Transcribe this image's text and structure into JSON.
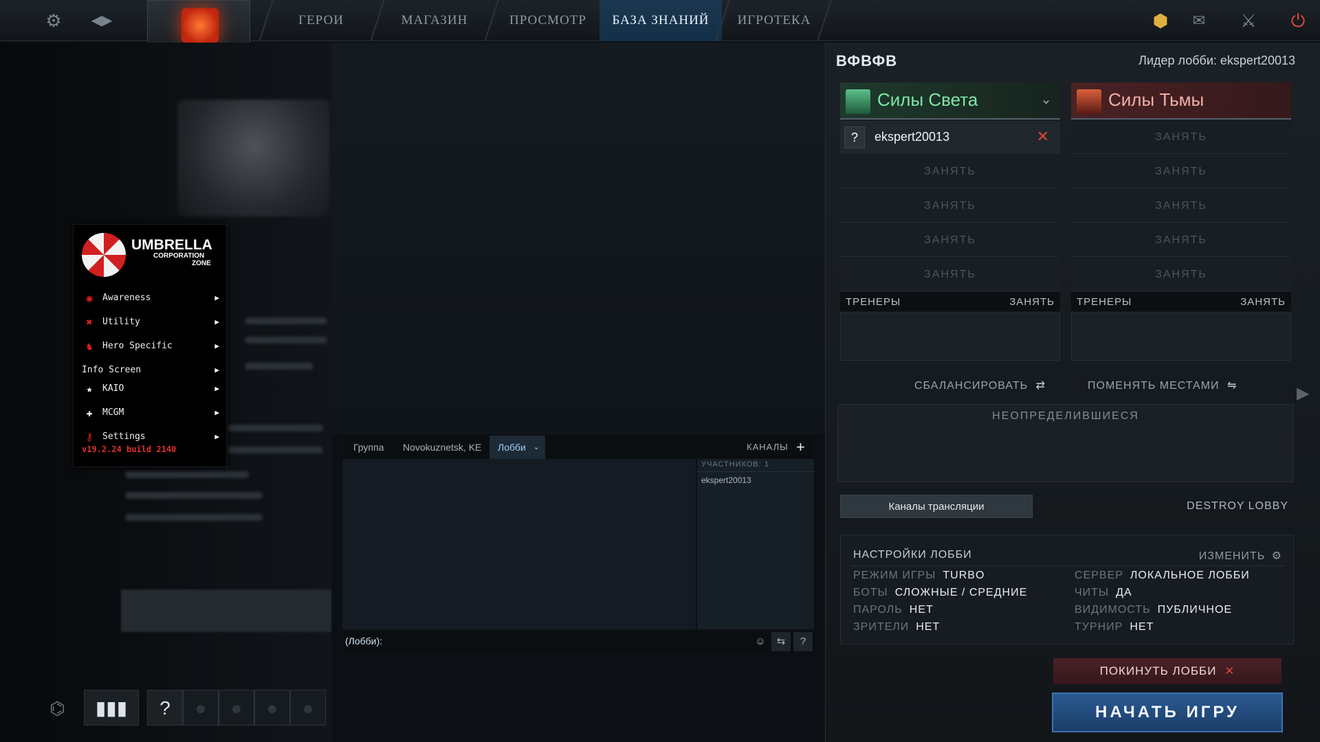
{
  "nav": {
    "items": [
      "ГЕРОИ",
      "МАГАЗИН",
      "ПРОСМОТР",
      "БАЗА ЗНАНИЙ",
      "ИГРОТЕКА"
    ],
    "active_index": 3
  },
  "umbrella_menu": {
    "logo_line1": "UMBRELLA",
    "logo_line2": "CORPORATION",
    "logo_line3": "ZONE",
    "items": [
      {
        "icon": "eye-icon",
        "label": "Awareness"
      },
      {
        "icon": "tools-icon",
        "label": "Utility"
      },
      {
        "icon": "hero-icon",
        "label": "Hero Specific"
      },
      {
        "icon": "",
        "label": "Info Screen"
      },
      {
        "icon": "star-icon",
        "label": "KAIO"
      },
      {
        "icon": "plus-icon",
        "label": "MCGM"
      },
      {
        "icon": "settings-key-icon",
        "label": "Settings"
      }
    ],
    "version": "v19.2.24 build 2140"
  },
  "chat": {
    "tabs": [
      "Группа",
      "Novokuznetsk, KE",
      "Лобби"
    ],
    "active_tab": 2,
    "channels_label": "КАНАЛЫ",
    "members_header": "УЧАСТНИКОВ: 1",
    "members": [
      "ekspert20013"
    ],
    "input_prefix": "(Лобби):"
  },
  "lobby": {
    "name": "ВФВФВ",
    "leader": "Лидер лобби: ekspert20013",
    "radiant": {
      "name": "Силы Света",
      "slots": [
        "ekspert20013",
        "ЗАНЯТЬ",
        "ЗАНЯТЬ",
        "ЗАНЯТЬ",
        "ЗАНЯТЬ"
      ],
      "coaches_label": "ТРЕНЕРЫ",
      "coaches_take": "ЗАНЯТЬ"
    },
    "dire": {
      "name": "Силы Тьмы",
      "slots": [
        "ЗАНЯТЬ",
        "ЗАНЯТЬ",
        "ЗАНЯТЬ",
        "ЗАНЯТЬ",
        "ЗАНЯТЬ"
      ],
      "coaches_label": "ТРЕНЕРЫ",
      "coaches_take": "ЗАНЯТЬ"
    },
    "balance_label": "СБАЛАНСИРОВАТЬ",
    "swap_label": "ПОМЕНЯТЬ МЕСТАМИ",
    "unassigned_label": "НЕОПРЕДЕЛИВШИЕСЯ",
    "broadcast_label": "Каналы трансляции",
    "destroy_label": "DESTROY LOBBY",
    "settings": {
      "title": "НАСТРОЙКИ ЛОББИ",
      "edit": "ИЗМЕНИТЬ",
      "left": [
        {
          "k": "РЕЖИМ ИГРЫ",
          "v": "TURBO"
        },
        {
          "k": "БОТЫ",
          "v": "СЛОЖНЫЕ / СРЕДНИЕ"
        },
        {
          "k": "ПАРОЛЬ",
          "v": "НЕТ"
        },
        {
          "k": "ЗРИТЕЛИ",
          "v": "НЕТ"
        }
      ],
      "right": [
        {
          "k": "СЕРВЕР",
          "v": "ЛОКАЛЬНОЕ ЛОББИ"
        },
        {
          "k": "ЧИТЫ",
          "v": "ДА"
        },
        {
          "k": "ВИДИМОСТЬ",
          "v": "ПУБЛИЧНОЕ"
        },
        {
          "k": "ТУРНИР",
          "v": "НЕТ"
        }
      ]
    },
    "leave_label": "ПОКИНУТЬ ЛОББИ",
    "start_label": "НАЧАТЬ ИГРУ"
  },
  "colors": {
    "radiant": "#7fe7a8",
    "dire": "#f0b0a6",
    "accent": "#3c73b5",
    "danger": "#e0443a"
  }
}
